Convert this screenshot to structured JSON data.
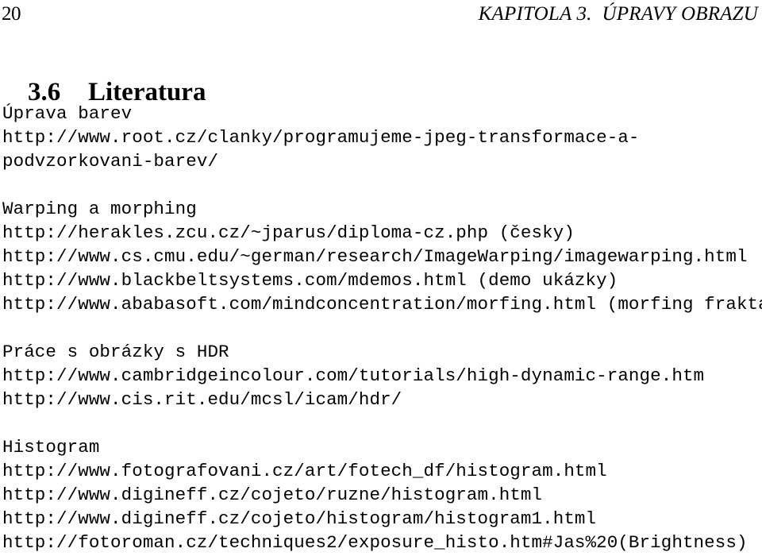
{
  "page": {
    "folio": "20",
    "running_head": "KAPITOLA 3.  ÚPRAVY OBRAZU",
    "background_color": "#ffffff",
    "text_color": "#000000"
  },
  "section": {
    "number": "3.6",
    "title": "Literatura"
  },
  "body": {
    "groups": [
      {
        "heading": "Úprava barev",
        "lines": [
          "http://www.root.cz/clanky/programujeme-jpeg-transformace-a-",
          "podvzorkovani-barev/"
        ]
      },
      {
        "heading": "Warping a morphing",
        "lines": [
          "http://herakles.zcu.cz/~jparus/diploma-cz.php (česky)",
          "http://www.cs.cmu.edu/~german/research/ImageWarping/imagewarping.html",
          "http://www.blackbeltsystems.com/mdemos.html (demo ukázky)",
          "http://www.ababasoft.com/mindconcentration/morfing.html (morfing fraktálů)"
        ]
      },
      {
        "heading": "Práce s obrázky s HDR",
        "lines": [
          "http://www.cambridgeincolour.com/tutorials/high-dynamic-range.htm",
          "http://www.cis.rit.edu/mcsl/icam/hdr/"
        ]
      },
      {
        "heading": "Histogram",
        "lines": [
          "http://www.fotografovani.cz/art/fotech_df/histogram.html",
          "http://www.digineff.cz/cojeto/ruzne/histogram.html",
          "http://www.digineff.cz/cojeto/histogram/histogram1.html",
          "http://fotoroman.cz/techniques2/exposure_histo.htm#Jas%20(Brightness)"
        ]
      }
    ]
  },
  "flat_lines": [
    "Úprava barev",
    "http://www.root.cz/clanky/programujeme-jpeg-transformace-a-",
    "podvzorkovani-barev/",
    "",
    "Warping a morphing",
    "http://herakles.zcu.cz/~jparus/diploma-cz.php (česky)",
    "http://www.cs.cmu.edu/~german/research/ImageWarping/imagewarping.html",
    "http://www.blackbeltsystems.com/mdemos.html (demo ukázky)",
    "http://www.ababasoft.com/mindconcentration/morfing.html (morfing fraktálů)",
    "",
    "Práce s obrázky s HDR",
    "http://www.cambridgeincolour.com/tutorials/high-dynamic-range.htm",
    "http://www.cis.rit.edu/mcsl/icam/hdr/",
    "",
    "Histogram",
    "http://www.fotografovani.cz/art/fotech_df/histogram.html",
    "http://www.digineff.cz/cojeto/ruzne/histogram.html",
    "http://www.digineff.cz/cojeto/histogram/histogram1.html",
    "http://fotoroman.cz/techniques2/exposure_histo.htm#Jas%20(Brightness)"
  ]
}
